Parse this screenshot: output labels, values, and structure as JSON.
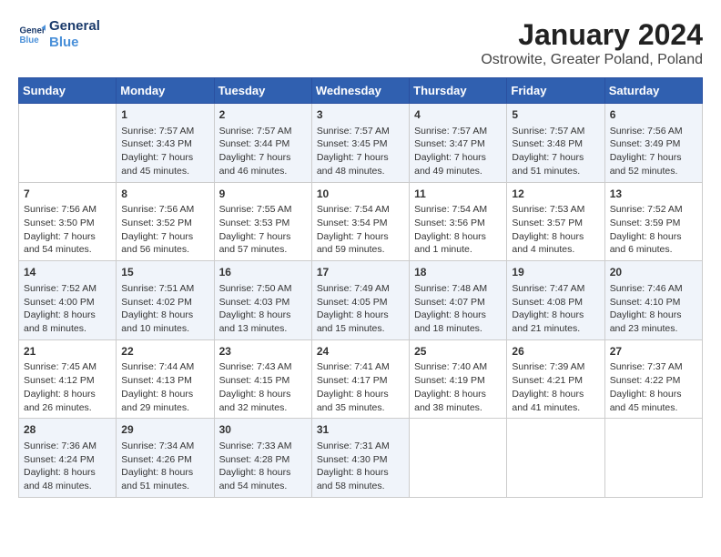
{
  "header": {
    "logo_line1": "General",
    "logo_line2": "Blue",
    "month": "January 2024",
    "location": "Ostrowite, Greater Poland, Poland"
  },
  "days_of_week": [
    "Sunday",
    "Monday",
    "Tuesday",
    "Wednesday",
    "Thursday",
    "Friday",
    "Saturday"
  ],
  "weeks": [
    [
      {
        "day": "",
        "content": ""
      },
      {
        "day": "1",
        "content": "Sunrise: 7:57 AM\nSunset: 3:43 PM\nDaylight: 7 hours\nand 45 minutes."
      },
      {
        "day": "2",
        "content": "Sunrise: 7:57 AM\nSunset: 3:44 PM\nDaylight: 7 hours\nand 46 minutes."
      },
      {
        "day": "3",
        "content": "Sunrise: 7:57 AM\nSunset: 3:45 PM\nDaylight: 7 hours\nand 48 minutes."
      },
      {
        "day": "4",
        "content": "Sunrise: 7:57 AM\nSunset: 3:47 PM\nDaylight: 7 hours\nand 49 minutes."
      },
      {
        "day": "5",
        "content": "Sunrise: 7:57 AM\nSunset: 3:48 PM\nDaylight: 7 hours\nand 51 minutes."
      },
      {
        "day": "6",
        "content": "Sunrise: 7:56 AM\nSunset: 3:49 PM\nDaylight: 7 hours\nand 52 minutes."
      }
    ],
    [
      {
        "day": "7",
        "content": "Sunrise: 7:56 AM\nSunset: 3:50 PM\nDaylight: 7 hours\nand 54 minutes."
      },
      {
        "day": "8",
        "content": "Sunrise: 7:56 AM\nSunset: 3:52 PM\nDaylight: 7 hours\nand 56 minutes."
      },
      {
        "day": "9",
        "content": "Sunrise: 7:55 AM\nSunset: 3:53 PM\nDaylight: 7 hours\nand 57 minutes."
      },
      {
        "day": "10",
        "content": "Sunrise: 7:54 AM\nSunset: 3:54 PM\nDaylight: 7 hours\nand 59 minutes."
      },
      {
        "day": "11",
        "content": "Sunrise: 7:54 AM\nSunset: 3:56 PM\nDaylight: 8 hours\nand 1 minute."
      },
      {
        "day": "12",
        "content": "Sunrise: 7:53 AM\nSunset: 3:57 PM\nDaylight: 8 hours\nand 4 minutes."
      },
      {
        "day": "13",
        "content": "Sunrise: 7:52 AM\nSunset: 3:59 PM\nDaylight: 8 hours\nand 6 minutes."
      }
    ],
    [
      {
        "day": "14",
        "content": "Sunrise: 7:52 AM\nSunset: 4:00 PM\nDaylight: 8 hours\nand 8 minutes."
      },
      {
        "day": "15",
        "content": "Sunrise: 7:51 AM\nSunset: 4:02 PM\nDaylight: 8 hours\nand 10 minutes."
      },
      {
        "day": "16",
        "content": "Sunrise: 7:50 AM\nSunset: 4:03 PM\nDaylight: 8 hours\nand 13 minutes."
      },
      {
        "day": "17",
        "content": "Sunrise: 7:49 AM\nSunset: 4:05 PM\nDaylight: 8 hours\nand 15 minutes."
      },
      {
        "day": "18",
        "content": "Sunrise: 7:48 AM\nSunset: 4:07 PM\nDaylight: 8 hours\nand 18 minutes."
      },
      {
        "day": "19",
        "content": "Sunrise: 7:47 AM\nSunset: 4:08 PM\nDaylight: 8 hours\nand 21 minutes."
      },
      {
        "day": "20",
        "content": "Sunrise: 7:46 AM\nSunset: 4:10 PM\nDaylight: 8 hours\nand 23 minutes."
      }
    ],
    [
      {
        "day": "21",
        "content": "Sunrise: 7:45 AM\nSunset: 4:12 PM\nDaylight: 8 hours\nand 26 minutes."
      },
      {
        "day": "22",
        "content": "Sunrise: 7:44 AM\nSunset: 4:13 PM\nDaylight: 8 hours\nand 29 minutes."
      },
      {
        "day": "23",
        "content": "Sunrise: 7:43 AM\nSunset: 4:15 PM\nDaylight: 8 hours\nand 32 minutes."
      },
      {
        "day": "24",
        "content": "Sunrise: 7:41 AM\nSunset: 4:17 PM\nDaylight: 8 hours\nand 35 minutes."
      },
      {
        "day": "25",
        "content": "Sunrise: 7:40 AM\nSunset: 4:19 PM\nDaylight: 8 hours\nand 38 minutes."
      },
      {
        "day": "26",
        "content": "Sunrise: 7:39 AM\nSunset: 4:21 PM\nDaylight: 8 hours\nand 41 minutes."
      },
      {
        "day": "27",
        "content": "Sunrise: 7:37 AM\nSunset: 4:22 PM\nDaylight: 8 hours\nand 45 minutes."
      }
    ],
    [
      {
        "day": "28",
        "content": "Sunrise: 7:36 AM\nSunset: 4:24 PM\nDaylight: 8 hours\nand 48 minutes."
      },
      {
        "day": "29",
        "content": "Sunrise: 7:34 AM\nSunset: 4:26 PM\nDaylight: 8 hours\nand 51 minutes."
      },
      {
        "day": "30",
        "content": "Sunrise: 7:33 AM\nSunset: 4:28 PM\nDaylight: 8 hours\nand 54 minutes."
      },
      {
        "day": "31",
        "content": "Sunrise: 7:31 AM\nSunset: 4:30 PM\nDaylight: 8 hours\nand 58 minutes."
      },
      {
        "day": "",
        "content": ""
      },
      {
        "day": "",
        "content": ""
      },
      {
        "day": "",
        "content": ""
      }
    ]
  ]
}
